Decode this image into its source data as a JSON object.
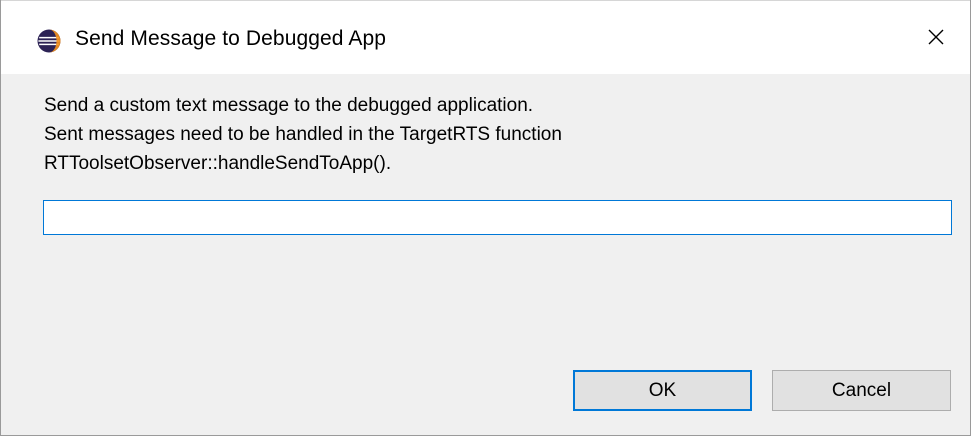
{
  "dialog": {
    "title": "Send Message to Debugged App",
    "icon": "eclipse-icon",
    "close_icon": "close-icon"
  },
  "description": {
    "line1": "Send a custom text message to the debugged application.",
    "line2": "Sent messages need to be handled in the TargetRTS function",
    "line3": "RTToolsetObserver::handleSendToApp()."
  },
  "message_input": {
    "value": "",
    "placeholder": ""
  },
  "buttons": {
    "ok_label": "OK",
    "cancel_label": "Cancel"
  },
  "colors": {
    "accent": "#0078d7",
    "dialog_background": "#f0f0f0",
    "titlebar_background": "#ffffff",
    "button_background": "#e1e1e1"
  }
}
